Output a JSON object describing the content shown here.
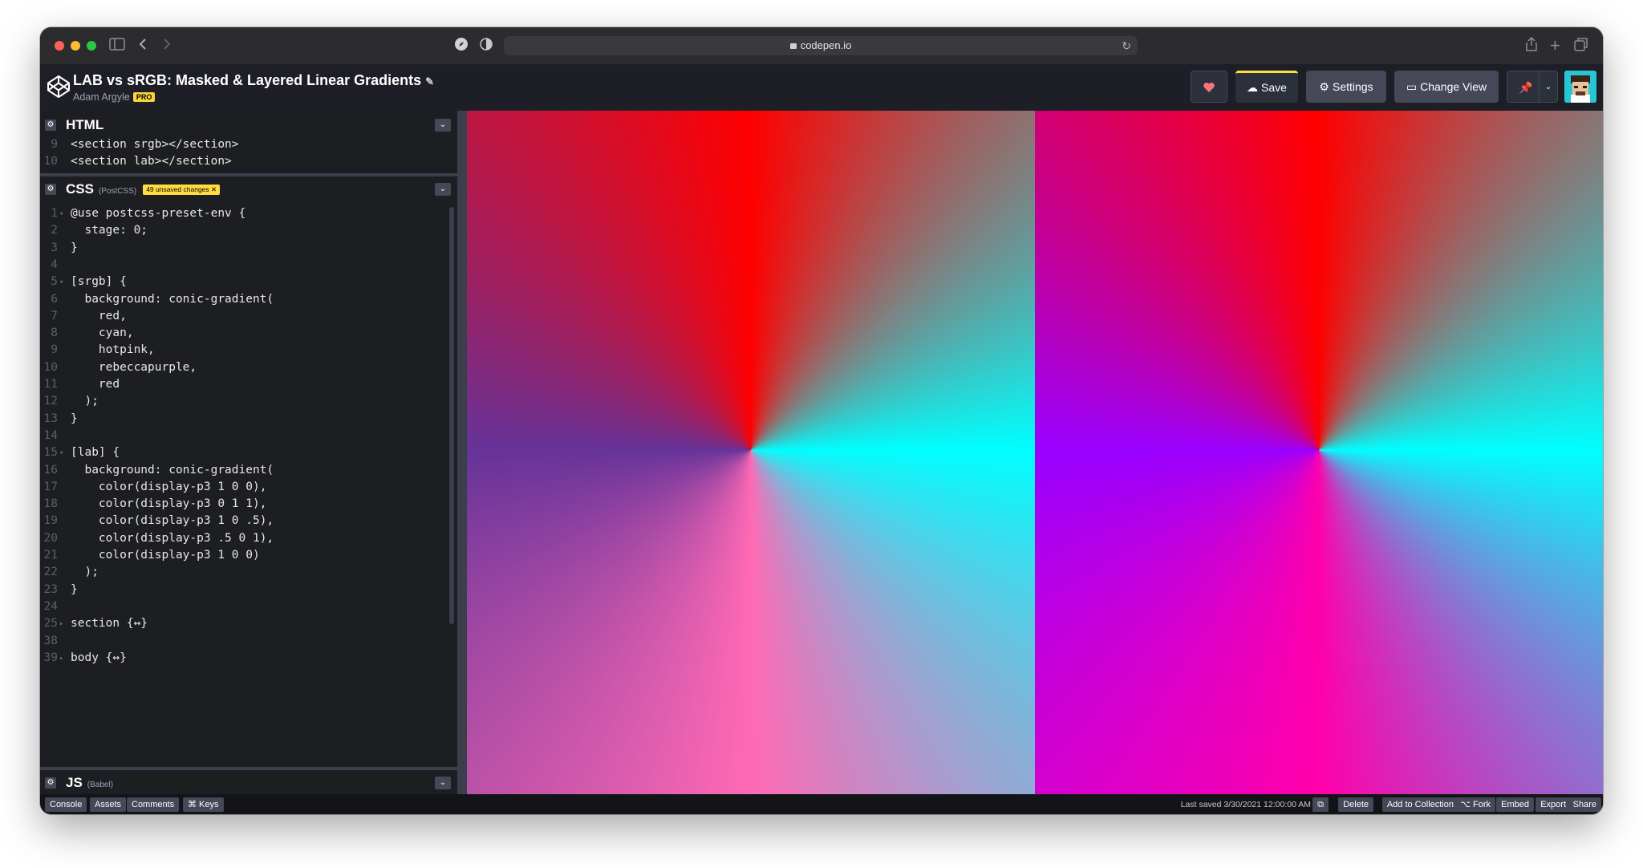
{
  "browser": {
    "url": "codepen.io"
  },
  "pen": {
    "title": "LAB vs sRGB: Masked & Layered Linear Gradients",
    "author": "Adam Argyle",
    "author_badge": "PRO"
  },
  "header_buttons": {
    "save": "Save",
    "settings": "Settings",
    "change_view": "Change View"
  },
  "html_panel": {
    "title": "HTML",
    "lines": [
      {
        "n": "9",
        "text": "<section srgb></section>"
      },
      {
        "n": "10",
        "text": "<section lab></section>"
      }
    ]
  },
  "css_panel": {
    "title": "CSS",
    "preprocessor": "(PostCSS)",
    "badge": "49 unsaved changes",
    "lines": [
      {
        "n": "1",
        "text": "@use postcss-preset-env {"
      },
      {
        "n": "2",
        "text": "  stage: 0;"
      },
      {
        "n": "3",
        "text": "}"
      },
      {
        "n": "4",
        "text": ""
      },
      {
        "n": "5",
        "text": "[srgb] {"
      },
      {
        "n": "6",
        "text": "  background: conic-gradient("
      },
      {
        "n": "7",
        "text": "    red,"
      },
      {
        "n": "8",
        "text": "    cyan,"
      },
      {
        "n": "9",
        "text": "    hotpink,"
      },
      {
        "n": "10",
        "text": "    rebeccapurple,"
      },
      {
        "n": "11",
        "text": "    red"
      },
      {
        "n": "12",
        "text": "  );"
      },
      {
        "n": "13",
        "text": "}"
      },
      {
        "n": "14",
        "text": ""
      },
      {
        "n": "15",
        "text": "[lab] {"
      },
      {
        "n": "16",
        "text": "  background: conic-gradient("
      },
      {
        "n": "17",
        "text": "    color(display-p3 1 0 0),"
      },
      {
        "n": "18",
        "text": "    color(display-p3 0 1 1),"
      },
      {
        "n": "19",
        "text": "    color(display-p3 1 0 .5),"
      },
      {
        "n": "20",
        "text": "    color(display-p3 .5 0 1),"
      },
      {
        "n": "21",
        "text": "    color(display-p3 1 0 0)"
      },
      {
        "n": "22",
        "text": "  );"
      },
      {
        "n": "23",
        "text": "}"
      },
      {
        "n": "24",
        "text": ""
      },
      {
        "n": "25",
        "text": "section {↔}"
      },
      {
        "n": "38",
        "text": ""
      },
      {
        "n": "39",
        "text": "body {↔}"
      }
    ]
  },
  "js_panel": {
    "title": "JS",
    "preprocessor": "(Babel)"
  },
  "footer": {
    "console": "Console",
    "assets": "Assets",
    "comments": "Comments",
    "keys": "⌘ Keys",
    "last_saved": "Last saved 3/30/2021 12:00:00 AM",
    "delete": "Delete",
    "add_to_collection": "Add to Collection",
    "fork": "⌥ Fork",
    "embed": "Embed",
    "export": "Export",
    "share": "Share"
  },
  "colors": {
    "save_accent": "#ffdd40",
    "header_bg": "#1e1f26",
    "editor_bg": "#1d1e22",
    "heart": "#f5777d"
  }
}
